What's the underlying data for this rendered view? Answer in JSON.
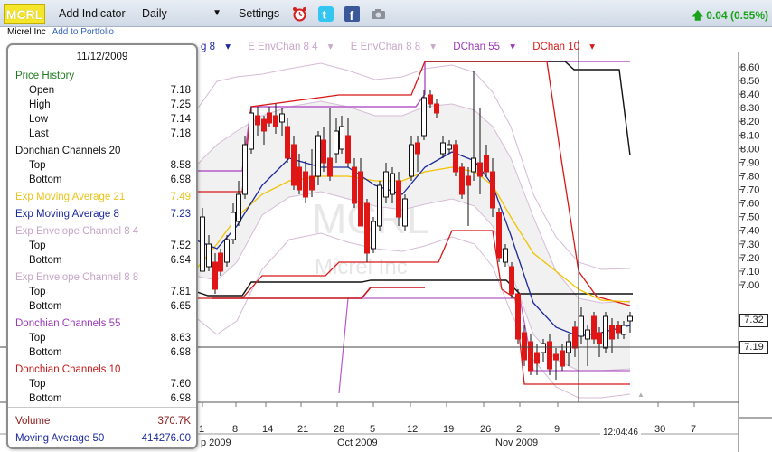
{
  "toolbar": {
    "symbol": "MCRL",
    "add_indicator": "Add Indicator",
    "period": "Daily",
    "settings": "Settings",
    "icons": [
      "alarm-clock-icon",
      "twitter-icon",
      "facebook-icon",
      "camera-icon"
    ],
    "quote": "0.04 (0.55%)"
  },
  "company": {
    "name": "Micrel Inc",
    "add_to_portfolio": "Add to Portfolio"
  },
  "legend": {
    "ema8": "g 8",
    "env84": "E EnvChan 8 4",
    "env88": "E EnvChan 8 8",
    "dc55": "DChan 55",
    "dc10": "DChan 10"
  },
  "watermark": {
    "symbol": "MCRL",
    "name": "Micrel Inc"
  },
  "panel": {
    "date": "11/12/2009",
    "price_history": "Price History",
    "open_label": "Open",
    "open": "7.18",
    "high_label": "High",
    "high": "7.25",
    "low_label": "Low",
    "low": "7.14",
    "last_label": "Last",
    "last": "7.18",
    "dc20": "Donchian Channels 20",
    "dc20_top_label": "Top",
    "dc20_top": "8.58",
    "dc20_bottom_label": "Bottom",
    "dc20_bottom": "6.98",
    "ema21_label": "Exp Moving Average 21",
    "ema21": "7.49",
    "ema8_label": "Exp Moving Average 8",
    "ema8": "7.23",
    "env84": "Exp Envelope Channel 8 4",
    "env84_top_label": "Top",
    "env84_top": "7.52",
    "env84_bottom_label": "Bottom",
    "env84_bottom": "6.94",
    "env88": "Exp Envelope Channel 8 8",
    "env88_top_label": "Top",
    "env88_top": "7.81",
    "env88_bottom_label": "Bottom",
    "env88_bottom": "6.65",
    "dc55": "Donchian Channels 55",
    "dc55_top_label": "Top",
    "dc55_top": "8.63",
    "dc55_bottom_label": "Bottom",
    "dc55_bottom": "6.98",
    "dc10": "Donchian Channels 10",
    "dc10_top_label": "Top",
    "dc10_top": "7.60",
    "dc10_bottom_label": "Bottom",
    "dc10_bottom": "6.98",
    "volume_label": "Volume",
    "volume": "370.7K",
    "ma50_label": "Moving Average 50",
    "ma50": "414276.00"
  },
  "axis": {
    "price_ticks": [
      "8.60",
      "8.50",
      "8.40",
      "8.30",
      "8.20",
      "8.10",
      "8.00",
      "7.90",
      "7.80",
      "7.70",
      "7.60",
      "7.50",
      "7.40",
      "7.30",
      "7.20",
      "7.10",
      "7.00"
    ],
    "date_ticks": [
      "1",
      "8",
      "14",
      "21",
      "28",
      "5",
      "12",
      "19",
      "26",
      "2",
      "9",
      "30",
      "7"
    ],
    "months": [
      "p 2009",
      "Oct 2009",
      "Nov 2009"
    ],
    "last_tag": "7.32",
    "cross_tag": "7.19",
    "crosshair_time": "12:04:46"
  },
  "colors": {
    "up": "#ffffff",
    "down": "#e01515",
    "ema21": "#f2c200",
    "ema8": "#1c2a9c",
    "env": "#d6bcd6",
    "dc10": "#d81818",
    "dc20": "#111111",
    "dc55": "#b55cc8",
    "dc20_highlight": "#c4101a"
  }
}
